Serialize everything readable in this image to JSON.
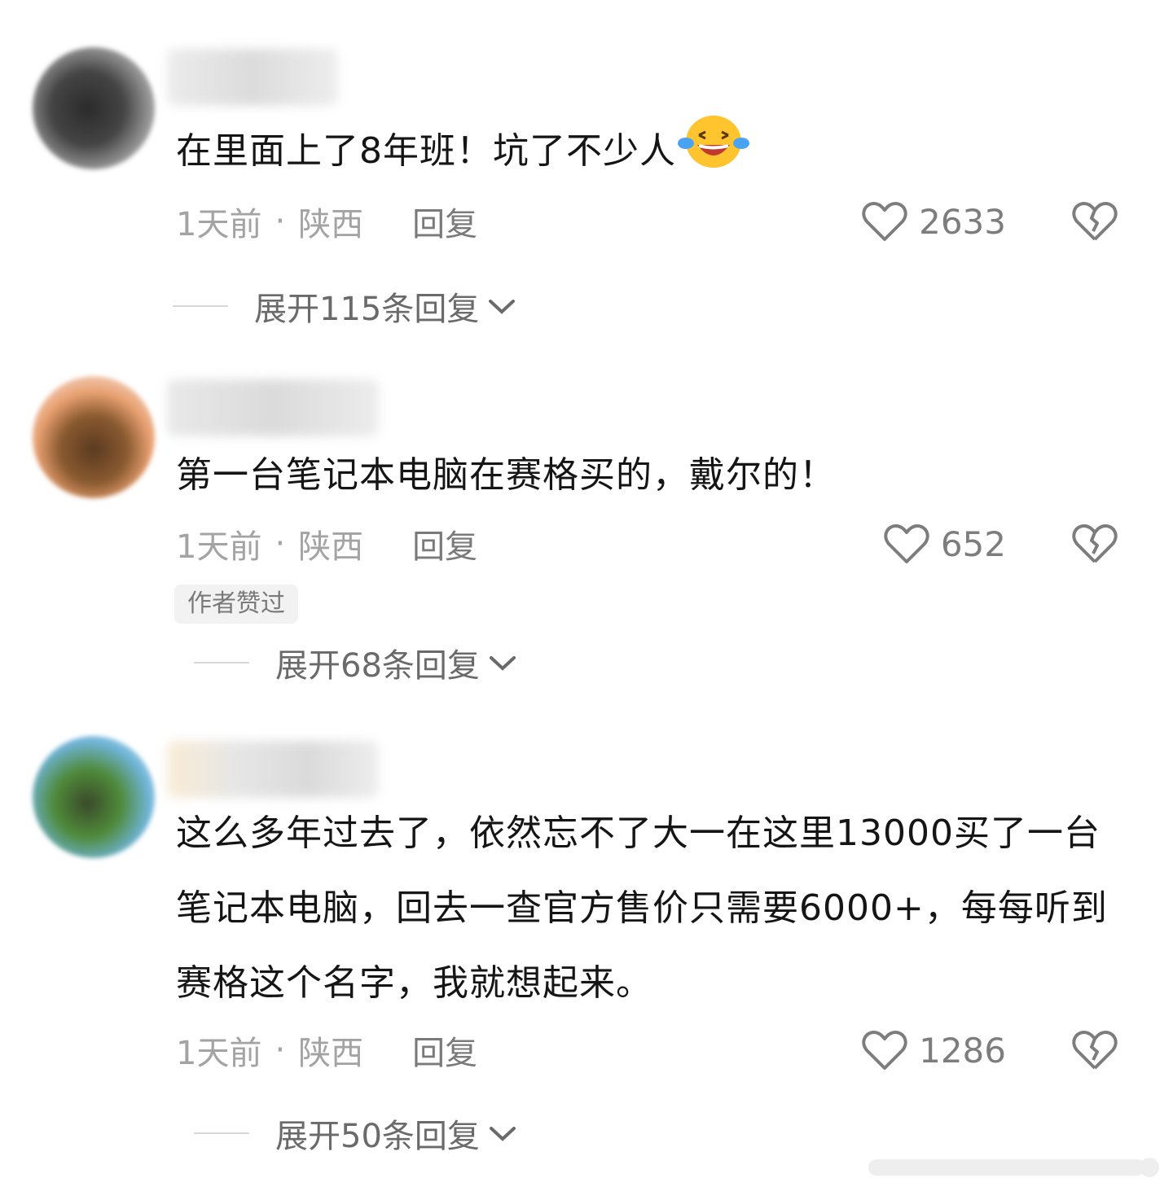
{
  "comments": [
    {
      "content": "在里面上了8年班！坑了不少人",
      "emoji": "laughing-crying-emoji",
      "time": "1天前",
      "separator": "·",
      "location": "陕西",
      "reply_label": "回复",
      "likes": "2633",
      "expand_label": "展开115条回复"
    },
    {
      "content": "第一台笔记本电脑在赛格买的，戴尔的！",
      "time": "1天前",
      "separator": "·",
      "location": "陕西",
      "reply_label": "回复",
      "likes": "652",
      "badge": "作者赞过",
      "expand_label": "展开68条回复"
    },
    {
      "content": "这么多年过去了，依然忘不了大一在这里13000买了一台笔记本电脑，回去一查官方售价只需要6000+，每每听到赛格这个名字，我就想起来。",
      "time": "1天前",
      "separator": "·",
      "location": "陕西",
      "reply_label": "回复",
      "likes": "1286",
      "expand_label": "展开50条回复"
    }
  ],
  "colors": {
    "text": "#151515",
    "meta": "#a3a3a3",
    "icon": "#7d7d7d",
    "emoji": "#ffc42e"
  }
}
